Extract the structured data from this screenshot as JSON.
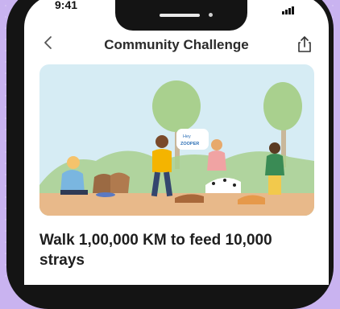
{
  "status_bar": {
    "time": "9:41"
  },
  "nav": {
    "back_icon": "chevron-left-icon",
    "title": "Community Challenge",
    "share_icon": "share-icon"
  },
  "hero": {
    "speech_bubble_line1": "Hey",
    "speech_bubble_line2": "ZOOPER"
  },
  "challenge": {
    "title": "Walk 1,00,000 KM to feed 10,000 strays"
  },
  "colors": {
    "background": "#c9b3f0",
    "hero_sky": "#d6ecf4",
    "ground": "#e8b98a",
    "tree": "#a9d08e"
  }
}
